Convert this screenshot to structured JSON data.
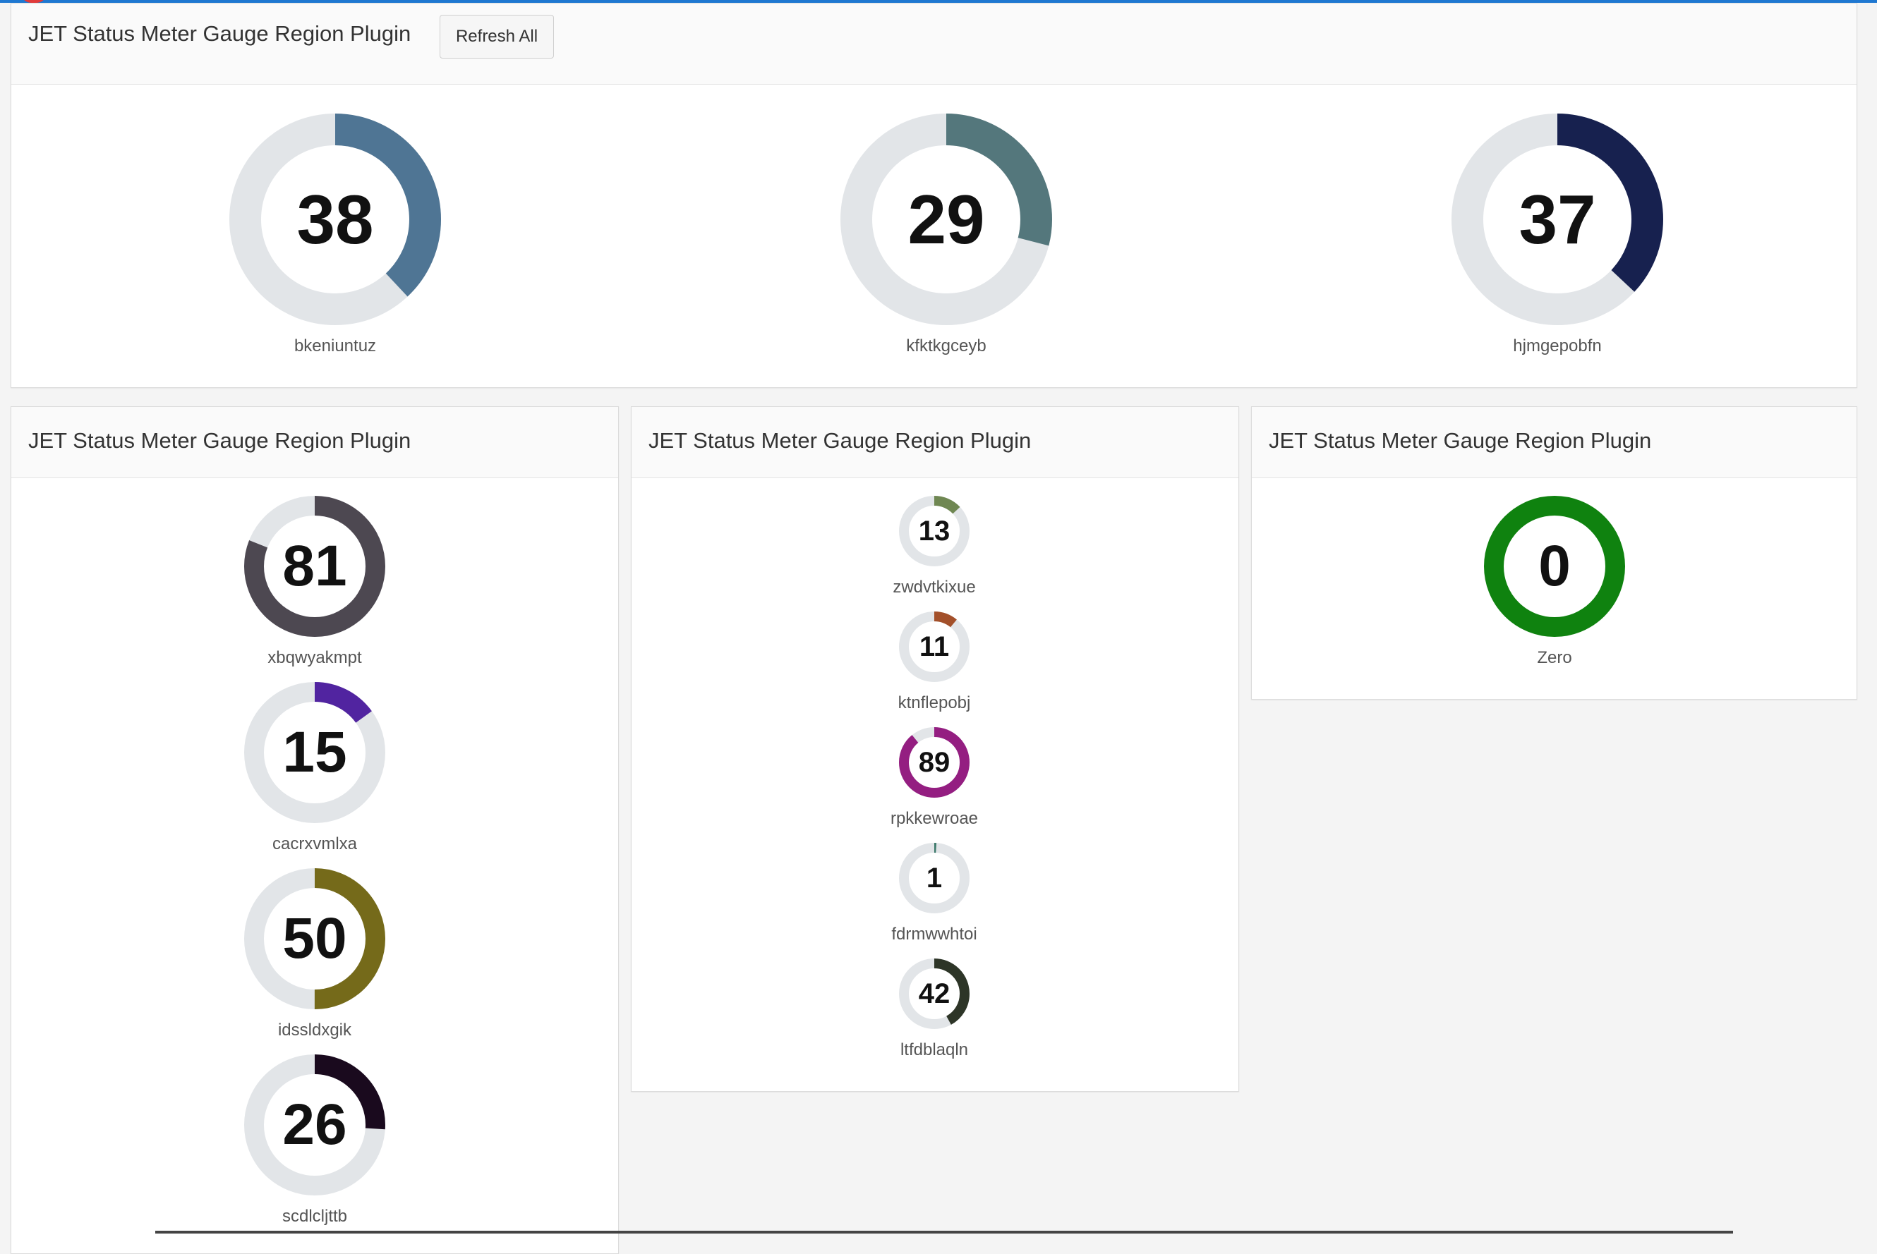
{
  "app": {
    "accent_color": "#1f78d1"
  },
  "top_region": {
    "title": "JET Status Meter Gauge Region Plugin",
    "refresh_label": "Refresh All",
    "gauges": [
      {
        "label": "bkeniuntuz",
        "value": "38",
        "color": "#4f7594"
      },
      {
        "label": "kfktkgceyb",
        "value": "29",
        "color": "#54777c"
      },
      {
        "label": "hjmgepobfn",
        "value": "37",
        "color": "#17214f"
      }
    ]
  },
  "left_region": {
    "title": "JET Status Meter Gauge Region Plugin",
    "gauges": [
      {
        "label": "xbqwyakmpt",
        "value": "81",
        "color": "#4d4851"
      },
      {
        "label": "cacrxvmlxa",
        "value": "15",
        "color": "#5124a0"
      },
      {
        "label": "idssldxgik",
        "value": "50",
        "color": "#756a1a"
      },
      {
        "label": "scdlcljttb",
        "value": "26",
        "color": "#1a0a1e"
      }
    ]
  },
  "middle_region": {
    "title": "JET Status Meter Gauge Region Plugin",
    "gauges": [
      {
        "label": "zwdvtkixue",
        "value": "13",
        "color": "#6f8752"
      },
      {
        "label": "ktnflepobj",
        "value": "11",
        "color": "#a3502a"
      },
      {
        "label": "rpkkewroae",
        "value": "89",
        "color": "#941e81"
      },
      {
        "label": "fdrmwwhtoi",
        "value": "1",
        "color": "#3d7a6b"
      },
      {
        "label": "ltfdblaqln",
        "value": "42",
        "color": "#2d3527"
      }
    ]
  },
  "right_region": {
    "title": "JET Status Meter Gauge Region Plugin",
    "gauges": [
      {
        "label": "Zero",
        "value": "0",
        "color": "#0f820f"
      }
    ]
  },
  "gauge_track_color": "#e2e5e8"
}
